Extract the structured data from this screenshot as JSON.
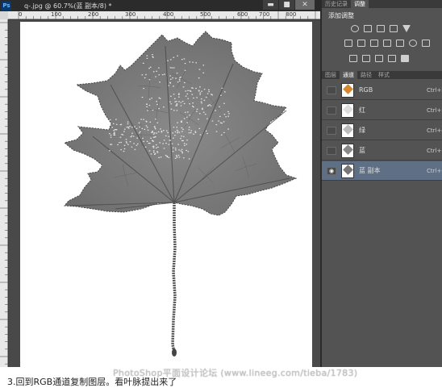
{
  "doc_window": {
    "app_icon": "Ps",
    "title": "q-.jpg @ 60.7%(蓝 副本/8) *",
    "min_glyph": "▬",
    "max_glyph": "■",
    "close_glyph": "✕",
    "ruler_ticks": [
      "0",
      "100",
      "200",
      "300",
      "400",
      "500",
      "600",
      "700",
      "800"
    ]
  },
  "panels": {
    "top_tabs": [
      "历史记录",
      "调整"
    ],
    "adjust_title": "添加调整",
    "lower_tabs": [
      "图层",
      "通道",
      "路径",
      "样式"
    ],
    "channels": [
      {
        "name": "RGB",
        "shortcut": "Ctrl+2",
        "visible": false,
        "selected": false,
        "thumb_color": "#d8882a"
      },
      {
        "name": "红",
        "shortcut": "Ctrl+3",
        "visible": false,
        "selected": false,
        "thumb_color": "#dddddd"
      },
      {
        "name": "绿",
        "shortcut": "Ctrl+4",
        "visible": false,
        "selected": false,
        "thumb_color": "#bbbbbb"
      },
      {
        "name": "蓝",
        "shortcut": "Ctrl+5",
        "visible": false,
        "selected": false,
        "thumb_color": "#888888"
      },
      {
        "name": "蓝 副本",
        "shortcut": "Ctrl+6",
        "visible": true,
        "selected": true,
        "thumb_color": "#777777"
      }
    ]
  },
  "caption": "3.回到RGB通道复制图层。看叶脉提出来了",
  "watermark": "PhotoShop平面设计论坛 (www.lineeg.com/tieba/1783)"
}
